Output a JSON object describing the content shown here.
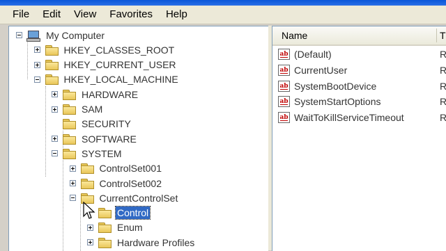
{
  "menu": [
    "File",
    "Edit",
    "View",
    "Favorites",
    "Help"
  ],
  "tree": [
    {
      "label": "My Computer",
      "expander": "minus",
      "icon": "computer-icon",
      "level": 0,
      "selected": false
    },
    {
      "label": "HKEY_CLASSES_ROOT",
      "expander": "plus",
      "icon": "folder-icon",
      "level": 1,
      "selected": false
    },
    {
      "label": "HKEY_CURRENT_USER",
      "expander": "plus",
      "icon": "folder-icon",
      "level": 1,
      "selected": false
    },
    {
      "label": "HKEY_LOCAL_MACHINE",
      "expander": "minus",
      "icon": "folder-icon",
      "level": 1,
      "selected": false
    },
    {
      "label": "HARDWARE",
      "expander": "plus",
      "icon": "folder-icon",
      "level": 2,
      "selected": false
    },
    {
      "label": "SAM",
      "expander": "plus",
      "icon": "folder-icon",
      "level": 2,
      "selected": false
    },
    {
      "label": "SECURITY",
      "expander": "none",
      "icon": "folder-icon",
      "level": 2,
      "selected": false
    },
    {
      "label": "SOFTWARE",
      "expander": "plus",
      "icon": "folder-icon",
      "level": 2,
      "selected": false
    },
    {
      "label": "SYSTEM",
      "expander": "minus",
      "icon": "folder-icon",
      "level": 2,
      "selected": false
    },
    {
      "label": "ControlSet001",
      "expander": "plus",
      "icon": "folder-icon",
      "level": 3,
      "selected": false
    },
    {
      "label": "ControlSet002",
      "expander": "plus",
      "icon": "folder-icon",
      "level": 3,
      "selected": false
    },
    {
      "label": "CurrentControlSet",
      "expander": "minus",
      "icon": "folder-icon",
      "level": 3,
      "selected": false
    },
    {
      "label": "Control",
      "expander": "none",
      "icon": "open-folder-icon",
      "level": 4,
      "selected": true
    },
    {
      "label": "Enum",
      "expander": "plus",
      "icon": "folder-icon",
      "level": 4,
      "selected": false
    },
    {
      "label": "Hardware Profiles",
      "expander": "plus",
      "icon": "folder-icon",
      "level": 4,
      "selected": false
    }
  ],
  "list": {
    "column_name": "Name",
    "column_next": "T",
    "items": [
      {
        "name": "(Default)",
        "type": "R",
        "icon": "string-value-icon"
      },
      {
        "name": "CurrentUser",
        "type": "R",
        "icon": "string-value-icon"
      },
      {
        "name": "SystemBootDevice",
        "type": "R",
        "icon": "string-value-icon"
      },
      {
        "name": "SystemStartOptions",
        "type": "R",
        "icon": "string-value-icon"
      },
      {
        "name": "WaitToKillServiceTimeout",
        "type": "R",
        "icon": "string-value-icon"
      }
    ]
  },
  "icon_label": "ab"
}
